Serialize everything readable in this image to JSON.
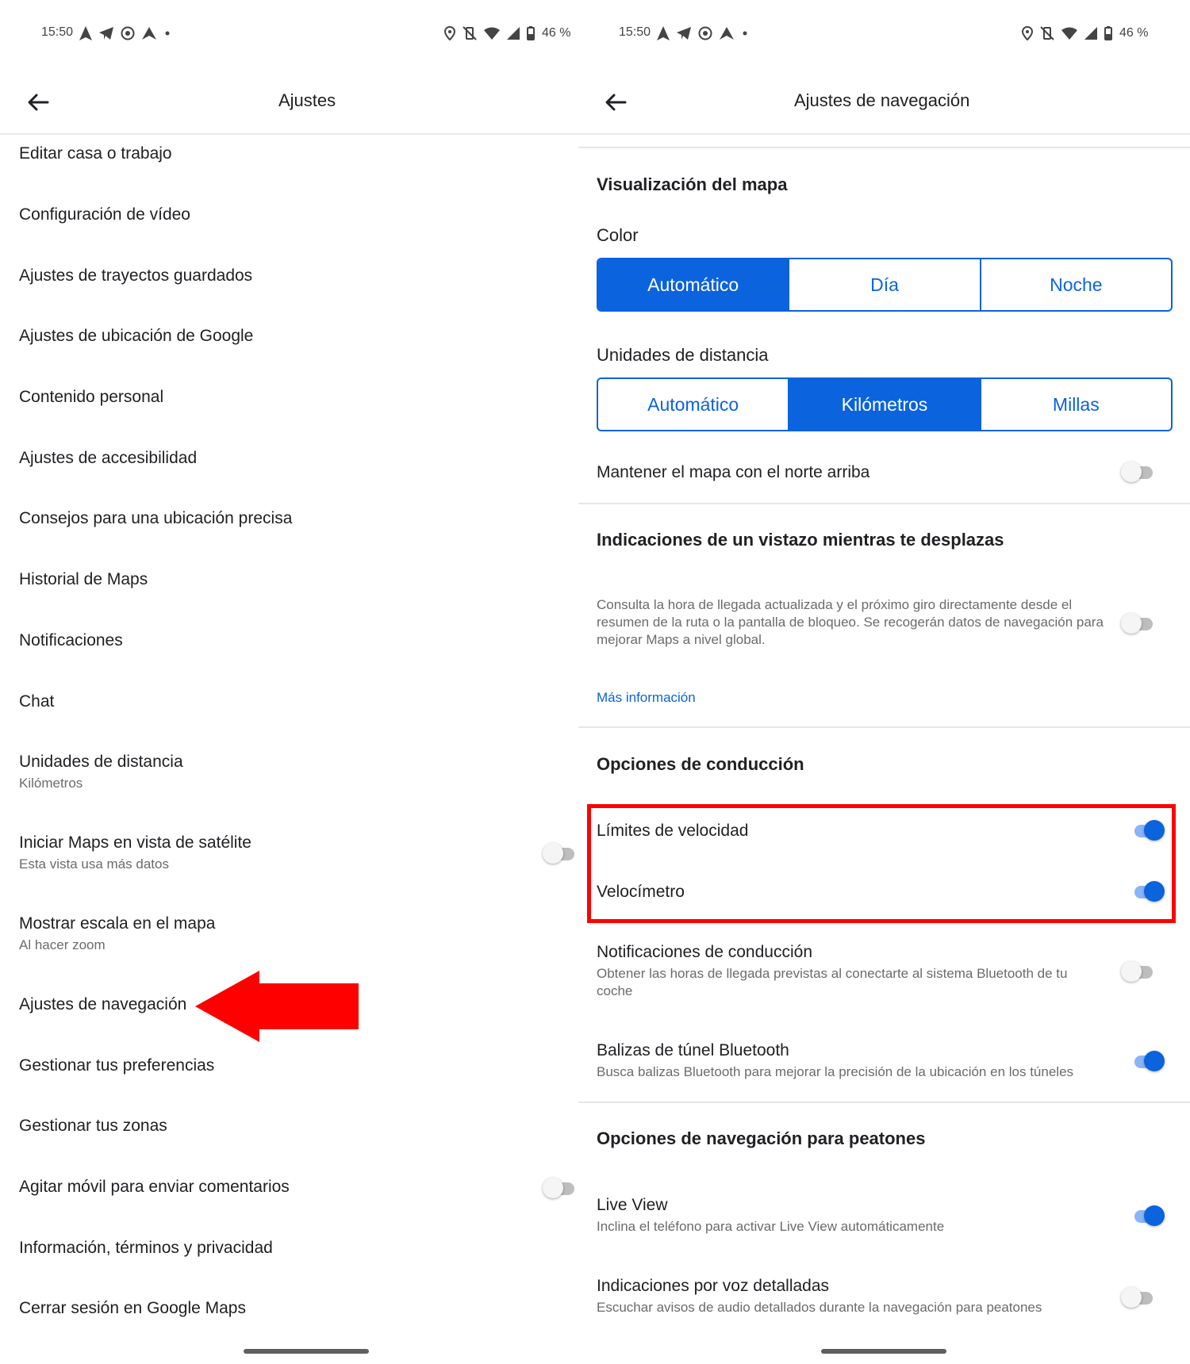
{
  "left": {
    "status": {
      "time": "15:50",
      "battery": "46 %"
    },
    "appbar": {
      "title": "Ajustes"
    },
    "items": [
      {
        "label": "Editar casa o trabajo"
      },
      {
        "label": "Configuración de vídeo"
      },
      {
        "label": "Ajustes de trayectos guardados"
      },
      {
        "label": "Ajustes de ubicación de Google"
      },
      {
        "label": "Contenido personal"
      },
      {
        "label": "Ajustes de accesibilidad"
      },
      {
        "label": "Consejos para una ubicación precisa"
      },
      {
        "label": "Historial de Maps"
      },
      {
        "label": "Notificaciones"
      },
      {
        "label": "Chat"
      },
      {
        "label": "Unidades de distancia",
        "sub": "Kilómetros"
      },
      {
        "label": "Iniciar Maps en vista de satélite",
        "sub": "Esta vista usa más datos",
        "toggle": false
      },
      {
        "label": "Mostrar escala en el mapa",
        "sub": "Al hacer zoom"
      },
      {
        "label": "Ajustes de navegación"
      },
      {
        "label": "Gestionar tus preferencias"
      },
      {
        "label": "Gestionar tus zonas"
      },
      {
        "label": "Agitar móvil para enviar comentarios",
        "toggle": false
      },
      {
        "label": "Información, términos y privacidad"
      },
      {
        "label": "Cerrar sesión en Google Maps"
      }
    ],
    "annotation_color": "#ff0000"
  },
  "right": {
    "status": {
      "time": "15:50",
      "battery": "46 %"
    },
    "appbar": {
      "title": "Ajustes de navegación"
    },
    "map_display": {
      "heading": "Visualización del mapa",
      "color_label": "Color",
      "color_options": [
        "Automático",
        "Día",
        "Noche"
      ],
      "color_selected": "Automático",
      "units_label": "Unidades de distancia",
      "units_options": [
        "Automático",
        "Kilómetros",
        "Millas"
      ],
      "units_selected": "Kilómetros",
      "north_up_label": "Mantener el mapa con el norte arriba",
      "north_up_on": false
    },
    "glance": {
      "heading": "Indicaciones de un vistazo mientras te desplazas",
      "description": "Consulta la hora de llegada actualizada y el próximo giro directamente desde el resumen de la ruta o la pantalla de bloqueo. Se recogerán datos de navegación para mejorar Maps a nivel global.",
      "toggle_on": false,
      "more_info": "Más información"
    },
    "driving": {
      "heading": "Opciones de conducción",
      "speed_limits": "Límites de velocidad",
      "speed_limits_on": true,
      "speedometer": "Velocímetro",
      "speedometer_on": true,
      "driving_notifications": "Notificaciones de conducción",
      "driving_notifications_sub": "Obtener las horas de llegada previstas al conectarte al sistema Bluetooth de tu coche",
      "driving_notifications_on": false,
      "tunnel_beacons": "Balizas de túnel Bluetooth",
      "tunnel_beacons_sub": "Busca balizas Bluetooth para mejorar la precisión de la ubicación en los túneles",
      "tunnel_beacons_on": true
    },
    "walking": {
      "heading": "Opciones de navegación para peatones",
      "live_view": "Live View",
      "live_view_sub": "Inclina el teléfono para activar Live View automáticamente",
      "live_view_on": true,
      "voice": "Indicaciones por voz detalladas",
      "voice_sub": "Escuchar avisos de audio detallados durante la navegación para peatones",
      "voice_on": false
    },
    "accent_color": "#0b63de",
    "highlight_color": "#ff0000"
  }
}
